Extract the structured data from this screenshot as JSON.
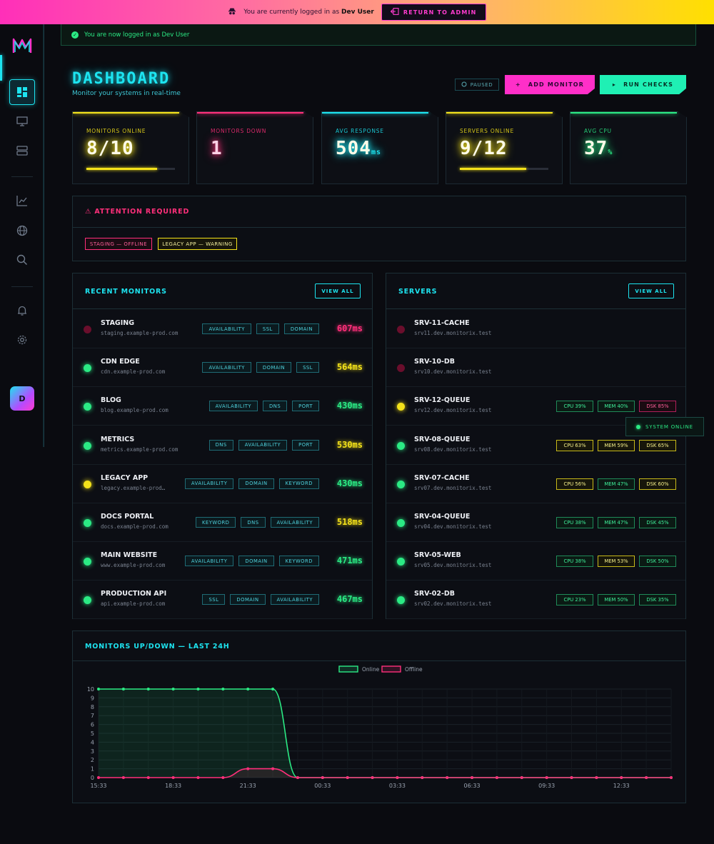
{
  "topbar": {
    "message": "You are currently logged in as",
    "user": "Dev User",
    "return_label": "RETURN TO ADMIN"
  },
  "notice": {
    "text": "You are now logged in as Dev User"
  },
  "header": {
    "title": "DASHBOARD",
    "subtitle": "Monitor your systems in real-time",
    "paused_label": "PAUSED",
    "add_label": "ADD MONITOR",
    "run_label": "RUN CHECKS"
  },
  "user": {
    "initial": "D"
  },
  "stats": [
    {
      "label": "MONITORS ONLINE",
      "value": "8/10",
      "unit": "",
      "progress": 0.8,
      "color": "#f4e21a"
    },
    {
      "label": "MONITORS DOWN",
      "value": "1",
      "unit": "",
      "progress": null,
      "color": "#ff2f7a"
    },
    {
      "label": "AVG RESPONSE",
      "value": "504",
      "unit": "ms",
      "progress": null,
      "color": "#1de4f0"
    },
    {
      "label": "SERVERS ONLINE",
      "value": "9/12",
      "unit": "",
      "progress": 0.75,
      "color": "#f4e21a"
    },
    {
      "label": "AVG CPU",
      "value": "37",
      "unit": "%",
      "progress": null,
      "color": "#2bea84"
    }
  ],
  "attention": {
    "title": "ATTENTION REQUIRED",
    "items": [
      {
        "label": "STAGING — OFFLINE",
        "kind": "offline"
      },
      {
        "label": "LEGACY APP — WARNING",
        "kind": "warning"
      }
    ]
  },
  "monitors": {
    "title": "RECENT MONITORS",
    "view_all": "VIEW ALL",
    "rows": [
      {
        "name": "STAGING",
        "url": "staging.example-prod.com",
        "tags": [
          "AVAILABILITY",
          "SSL",
          "DOMAIN"
        ],
        "response": "607ms",
        "status": "down"
      },
      {
        "name": "CDN EDGE",
        "url": "cdn.example-prod.com",
        "tags": [
          "AVAILABILITY",
          "DOMAIN",
          "SSL"
        ],
        "response": "564ms",
        "status": "up",
        "resp_color": "warn"
      },
      {
        "name": "BLOG",
        "url": "blog.example-prod.com",
        "tags": [
          "AVAILABILITY",
          "DNS",
          "PORT"
        ],
        "response": "430ms",
        "status": "up",
        "resp_color": "ok"
      },
      {
        "name": "METRICS",
        "url": "metrics.example-prod.com",
        "tags": [
          "DNS",
          "AVAILABILITY",
          "PORT"
        ],
        "response": "530ms",
        "status": "up",
        "resp_color": "warn"
      },
      {
        "name": "LEGACY APP",
        "url": "legacy.example-prod…",
        "tags": [
          "AVAILABILITY",
          "DOMAIN",
          "KEYWORD"
        ],
        "response": "430ms",
        "status": "warn",
        "resp_color": "ok"
      },
      {
        "name": "DOCS PORTAL",
        "url": "docs.example-prod.com",
        "tags": [
          "KEYWORD",
          "DNS",
          "AVAILABILITY"
        ],
        "response": "518ms",
        "status": "up",
        "resp_color": "warn"
      },
      {
        "name": "MAIN WEBSITE",
        "url": "www.example-prod.com",
        "tags": [
          "AVAILABILITY",
          "DOMAIN",
          "KEYWORD"
        ],
        "response": "471ms",
        "status": "up",
        "resp_color": "ok"
      },
      {
        "name": "PRODUCTION API",
        "url": "api.example-prod.com",
        "tags": [
          "SSL",
          "DOMAIN",
          "AVAILABILITY"
        ],
        "response": "467ms",
        "status": "up",
        "resp_color": "ok"
      }
    ]
  },
  "servers": {
    "title": "SERVERS",
    "view_all": "VIEW ALL",
    "tooltip": "SYSTEM ONLINE",
    "rows": [
      {
        "name": "SRV-11-CACHE",
        "host": "srv11.dev.monitorix.test",
        "status": "down",
        "metrics": []
      },
      {
        "name": "SRV-10-DB",
        "host": "srv10.dev.monitorix.test",
        "status": "down",
        "metrics": []
      },
      {
        "name": "SRV-12-QUEUE",
        "host": "srv12.dev.monitorix.test",
        "status": "warn",
        "metrics": [
          {
            "label": "CPU 39%",
            "level": "ok"
          },
          {
            "label": "MEM 40%",
            "level": "ok"
          },
          {
            "label": "DSK 85%",
            "level": "crit"
          }
        ]
      },
      {
        "name": "SRV-08-QUEUE",
        "host": "srv08.dev.monitorix.test",
        "status": "up",
        "metrics": [
          {
            "label": "CPU 63%",
            "level": "warn"
          },
          {
            "label": "MEM 59%",
            "level": "warn"
          },
          {
            "label": "DSK 65%",
            "level": "warn"
          }
        ]
      },
      {
        "name": "SRV-07-CACHE",
        "host": "srv07.dev.monitorix.test",
        "status": "up",
        "metrics": [
          {
            "label": "CPU 56%",
            "level": "warn"
          },
          {
            "label": "MEM 47%",
            "level": "ok"
          },
          {
            "label": "DSK 60%",
            "level": "warn"
          }
        ]
      },
      {
        "name": "SRV-04-QUEUE",
        "host": "srv04.dev.monitorix.test",
        "status": "up",
        "metrics": [
          {
            "label": "CPU 38%",
            "level": "ok"
          },
          {
            "label": "MEM 47%",
            "level": "ok"
          },
          {
            "label": "DSK 45%",
            "level": "ok"
          }
        ]
      },
      {
        "name": "SRV-05-WEB",
        "host": "srv05.dev.monitorix.test",
        "status": "up",
        "metrics": [
          {
            "label": "CPU 38%",
            "level": "ok"
          },
          {
            "label": "MEM 53%",
            "level": "warn"
          },
          {
            "label": "DSK 50%",
            "level": "ok"
          }
        ]
      },
      {
        "name": "SRV-02-DB",
        "host": "srv02.dev.monitorix.test",
        "status": "up",
        "metrics": [
          {
            "label": "CPU 23%",
            "level": "ok"
          },
          {
            "label": "MEM 50%",
            "level": "ok"
          },
          {
            "label": "DSK 35%",
            "level": "ok"
          }
        ]
      }
    ]
  },
  "colors": {
    "cyan": "#1de4f0",
    "green": "#2bea84",
    "yellow": "#f4e21a",
    "red": "#ff2f7a",
    "magenta": "#ff2fc8"
  },
  "chart_data": {
    "type": "line",
    "title": "MONITORS UP/DOWN — LAST 24H",
    "x": [
      "15:33",
      "16:33",
      "17:33",
      "18:33",
      "19:33",
      "20:33",
      "21:33",
      "22:33",
      "23:33",
      "00:33",
      "01:33",
      "02:33",
      "03:33",
      "04:33",
      "05:33",
      "06:33",
      "07:33",
      "08:33",
      "09:33",
      "10:33",
      "11:33",
      "12:33",
      "13:33",
      "14:33"
    ],
    "x_tick_labels": [
      "15:33",
      "18:33",
      "21:33",
      "00:33",
      "03:33",
      "06:33",
      "09:33",
      "12:33"
    ],
    "series": [
      {
        "name": "Online",
        "color": "#2bea84",
        "values": [
          10,
          10,
          10,
          10,
          10,
          10,
          10,
          10,
          0,
          0,
          0,
          0,
          0,
          0,
          0,
          0,
          0,
          0,
          0,
          0,
          0,
          0,
          0,
          0
        ]
      },
      {
        "name": "Offline",
        "color": "#ff2f7a",
        "values": [
          0,
          0,
          0,
          0,
          0,
          0,
          1,
          1,
          0,
          0,
          0,
          0,
          0,
          0,
          0,
          0,
          0,
          0,
          0,
          0,
          0,
          0,
          0,
          0
        ]
      }
    ],
    "ylim": [
      0,
      10
    ],
    "y_ticks": [
      0,
      1,
      2,
      3,
      4,
      5,
      6,
      7,
      8,
      9,
      10
    ],
    "grid": true,
    "legend": "top-center"
  }
}
